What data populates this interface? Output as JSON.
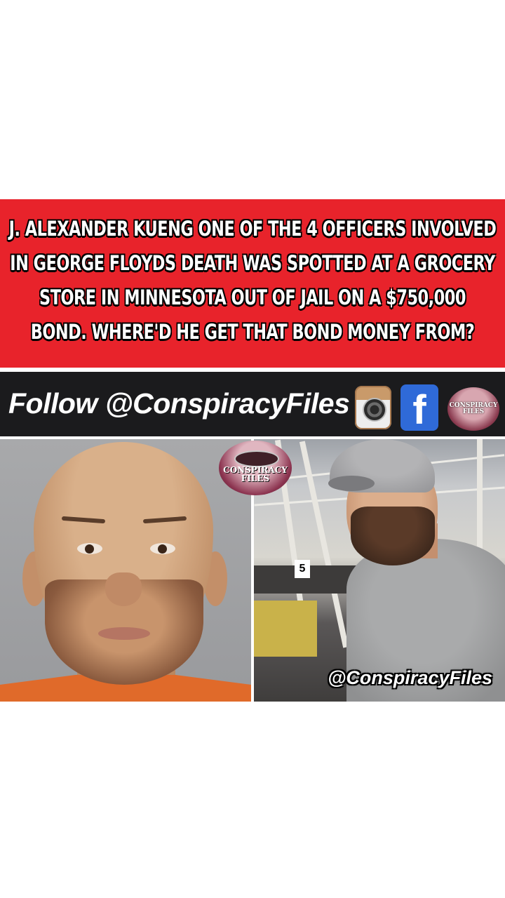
{
  "headline": {
    "lines": [
      "J. ALEXANDER KUENG ONE OF THE 4 OFFICERS INVOLVED",
      "IN GEORGE FLOYDS DEATH WAS SPOTTED AT A GROCERY",
      "STORE IN MINNESOTA OUT OF JAIL ON A $750,000",
      "BOND. WHERE'D HE GET THAT BOND MONEY FROM?"
    ],
    "background_color": "#e8232b",
    "text_color": "#ffffff"
  },
  "follow_bar": {
    "text": "Follow @ConspiracyFiles",
    "background_color": "#1b1b1d",
    "icons": [
      "instagram-icon",
      "facebook-icon",
      "conspiracy-files-logo"
    ],
    "facebook_glyph": "f"
  },
  "logos": {
    "badge_text_line1": "CONSPIRACY",
    "badge_text_line2": "FILES"
  },
  "photos": {
    "left_description_icon": "mugshot-photo",
    "right_description_icon": "grocery-store-photo",
    "aisle_number": "5",
    "watermark": "@ConspiracyFiles"
  }
}
